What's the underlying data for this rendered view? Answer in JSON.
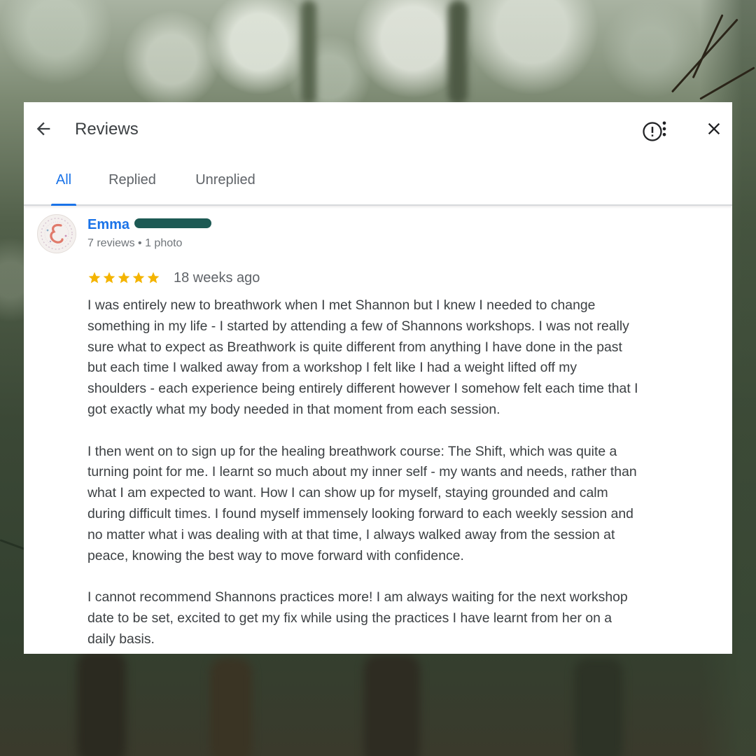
{
  "header": {
    "title": "Reviews",
    "back_icon": "arrow-back-icon",
    "more_icon": "more-vert-icon",
    "close_icon": "close-icon"
  },
  "tabs": [
    {
      "label": "All",
      "active": true
    },
    {
      "label": "Replied",
      "active": false
    },
    {
      "label": "Unreplied",
      "active": false
    }
  ],
  "review": {
    "author": "Emma",
    "meta": "7 reviews • 1 photo",
    "rating": 5,
    "age": "18 weeks ago",
    "report_icon": "report-icon",
    "paragraphs": [
      "I was entirely new to breathwork when I met Shannon but I knew I needed to change\nsomething in my life - I started by attending a few of Shannons workshops. I was not really\nsure what to expect as Breathwork is quite different from anything I have done in the past\nbut each time I walked away from a workshop I felt like I had a weight lifted off my\nshoulders - each experience being entirely different however I somehow felt each time that I\ngot exactly what my body needed in that moment from each session.",
      "I then went on to sign up for the healing breathwork course: The Shift, which was quite a\nturning point for me. I learnt so much about my inner self - my wants and needs, rather than\nwhat I am expected to want. How I can show up for myself, staying grounded and calm\nduring difficult times. I found myself immensely looking forward to each weekly session and\nno matter what i was dealing with at that time, I always walked away from the session at\npeace, knowing the best way to move forward with confidence.",
      "I cannot recommend Shannons practices more! I am always waiting for the next workshop\ndate to be set, excited to get my fix while using the practices I have learnt from her on a\ndaily basis."
    ]
  },
  "colors": {
    "accent": "#1a73e8",
    "star": "#f4b400",
    "text": "#3c4043",
    "muted": "#70757a"
  }
}
